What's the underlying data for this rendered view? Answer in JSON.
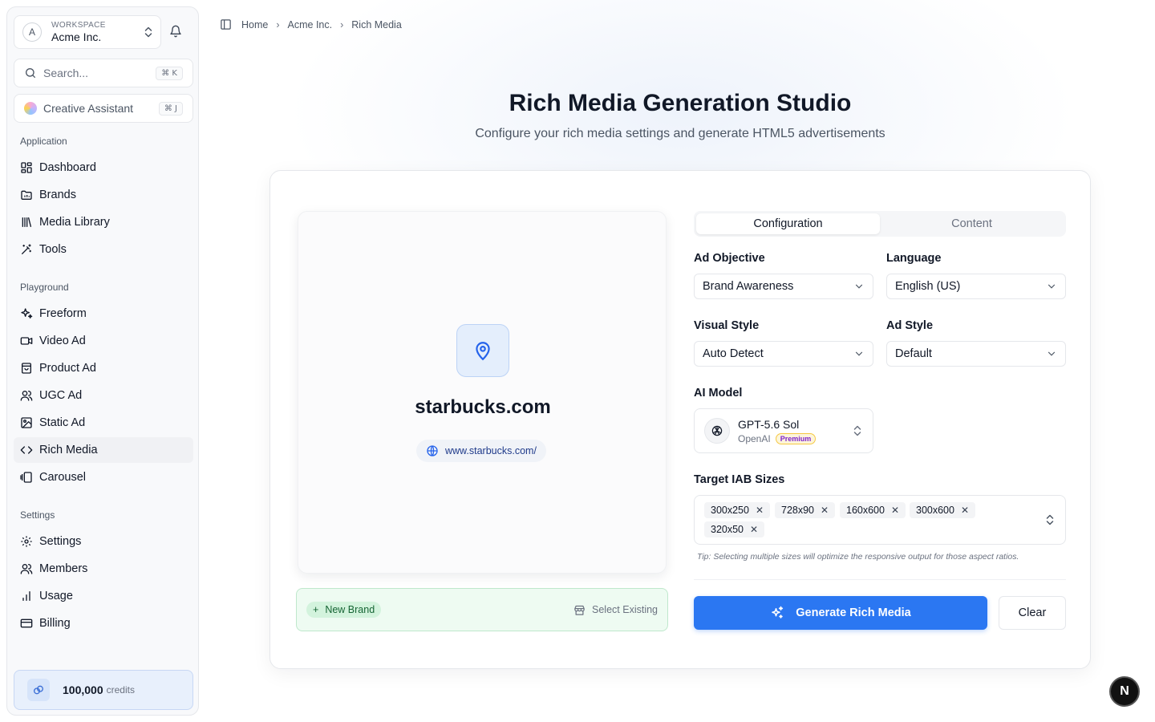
{
  "workspace": {
    "label": "WORKSPACE",
    "name": "Acme Inc.",
    "avatar_letter": "A"
  },
  "search": {
    "placeholder": "Search...",
    "shortcut": "⌘ K"
  },
  "assistant": {
    "label": "Creative Assistant",
    "shortcut": "⌘ J"
  },
  "sidebar": {
    "sections": [
      {
        "title": "Application",
        "items": [
          {
            "label": "Dashboard",
            "icon": "dashboard-icon"
          },
          {
            "label": "Brands",
            "icon": "brands-icon"
          },
          {
            "label": "Media Library",
            "icon": "library-icon"
          },
          {
            "label": "Tools",
            "icon": "wand-icon"
          }
        ]
      },
      {
        "title": "Playground",
        "items": [
          {
            "label": "Freeform",
            "icon": "sparkles-icon"
          },
          {
            "label": "Video Ad",
            "icon": "video-icon"
          },
          {
            "label": "Product Ad",
            "icon": "shopping-bag-icon"
          },
          {
            "label": "UGC Ad",
            "icon": "users-icon"
          },
          {
            "label": "Static Ad",
            "icon": "image-icon"
          },
          {
            "label": "Rich Media",
            "icon": "code-icon",
            "active": true
          },
          {
            "label": "Carousel",
            "icon": "carousel-icon"
          }
        ]
      },
      {
        "title": "Settings",
        "items": [
          {
            "label": "Settings",
            "icon": "gear-icon"
          },
          {
            "label": "Members",
            "icon": "members-icon"
          },
          {
            "label": "Usage",
            "icon": "bar-chart-icon"
          },
          {
            "label": "Billing",
            "icon": "credit-card-icon"
          }
        ]
      }
    ]
  },
  "credits": {
    "amount": "100,000",
    "unit": "credits"
  },
  "breadcrumb": [
    "Home",
    "Acme Inc.",
    "Rich Media"
  ],
  "header": {
    "title": "Rich Media Generation Studio",
    "subtitle": "Configure your rich media settings and generate HTML5 advertisements"
  },
  "preview": {
    "domain": "starbucks.com",
    "url": "www.starbucks.com/"
  },
  "brand_bar": {
    "new_brand": "New Brand",
    "select_existing": "Select Existing"
  },
  "tabs": [
    {
      "label": "Configuration",
      "active": true
    },
    {
      "label": "Content",
      "active": false
    }
  ],
  "form": {
    "ad_objective": {
      "label": "Ad Objective",
      "value": "Brand Awareness"
    },
    "language": {
      "label": "Language",
      "value": "English (US)"
    },
    "visual_style": {
      "label": "Visual Style",
      "value": "Auto Detect"
    },
    "ad_style": {
      "label": "Ad Style",
      "value": "Default"
    },
    "ai_model": {
      "label": "AI Model",
      "name": "GPT-5.6 Sol",
      "vendor": "OpenAI",
      "badge": "Premium"
    },
    "iab_sizes": {
      "label": "Target IAB Sizes",
      "chips": [
        "300x250",
        "728x90",
        "160x600",
        "300x600",
        "320x50"
      ],
      "tip": "Tip: Selecting multiple sizes will optimize the responsive output for those aspect ratios."
    }
  },
  "actions": {
    "generate": "Generate Rich Media",
    "clear": "Clear"
  },
  "colors": {
    "primary": "#2b77f2",
    "success_bg": "#eefbf2",
    "credits_bg": "#e8f0fc"
  },
  "dev_badge": "N"
}
